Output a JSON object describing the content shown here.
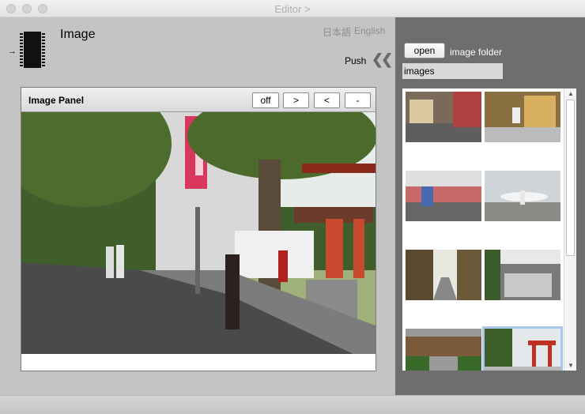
{
  "window": {
    "title": "Editor >"
  },
  "header": {
    "title": "Image",
    "lang_ja": "日本語",
    "lang_en": "English",
    "push_label": "Push",
    "push_icon": "double-chevron-left-icon"
  },
  "panel": {
    "title": "Image Panel",
    "buttons": {
      "off": "off",
      "next": ">",
      "prev": "<",
      "minus": "-"
    }
  },
  "folder": {
    "open_label": "open",
    "label": "image folder",
    "value": "images"
  },
  "thumbnails": [
    "street-thumbnail",
    "shop-front-thumbnail",
    "busy-street-thumbnail",
    "airplane-thumbnail",
    "narrow-lane-thumbnail",
    "rooftops-thumbnail",
    "temple-garden-thumbnail",
    "shrine-gate-thumbnail"
  ],
  "colors": {
    "right_pane": "#6e6e6e",
    "selection": "#a8c7ea"
  }
}
